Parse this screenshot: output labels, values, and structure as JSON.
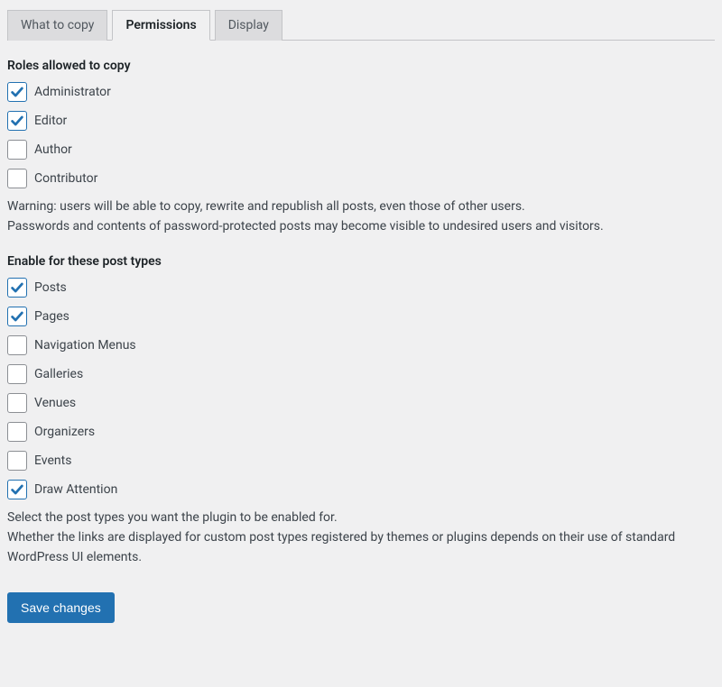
{
  "tabs": [
    {
      "label": "What to copy",
      "active": false
    },
    {
      "label": "Permissions",
      "active": true
    },
    {
      "label": "Display",
      "active": false
    }
  ],
  "sections": {
    "roles": {
      "title": "Roles allowed to copy",
      "items": [
        {
          "label": "Administrator",
          "checked": true
        },
        {
          "label": "Editor",
          "checked": true
        },
        {
          "label": "Author",
          "checked": false
        },
        {
          "label": "Contributor",
          "checked": false
        }
      ],
      "description": "Warning: users will be able to copy, rewrite and republish all posts, even those of other users.\nPasswords and contents of password-protected posts may become visible to undesired users and visitors."
    },
    "post_types": {
      "title": "Enable for these post types",
      "items": [
        {
          "label": "Posts",
          "checked": true
        },
        {
          "label": "Pages",
          "checked": true
        },
        {
          "label": "Navigation Menus",
          "checked": false
        },
        {
          "label": "Galleries",
          "checked": false
        },
        {
          "label": "Venues",
          "checked": false
        },
        {
          "label": "Organizers",
          "checked": false
        },
        {
          "label": "Events",
          "checked": false
        },
        {
          "label": "Draw Attention",
          "checked": true
        }
      ],
      "description": "Select the post types you want the plugin to be enabled for.\nWhether the links are displayed for custom post types registered by themes or plugins depends on their use of standard WordPress UI elements."
    }
  },
  "submit_label": "Save changes"
}
